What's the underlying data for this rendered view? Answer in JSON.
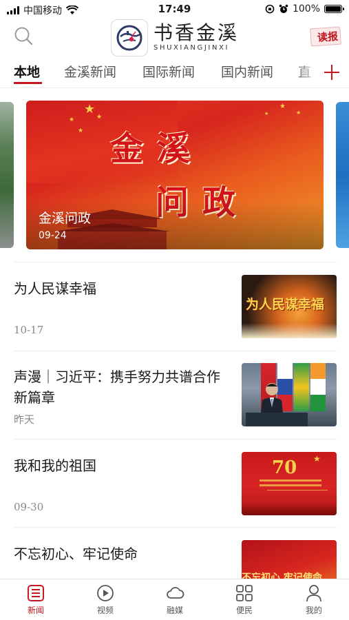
{
  "status_bar": {
    "carrier": "中国移动",
    "time": "17:49",
    "battery_text": "100%",
    "battery_level": 1.0
  },
  "header": {
    "logo_title": "书香金溪",
    "logo_subtitle": "SHUXIANGJINXI",
    "read_paper_label": "读报",
    "icons": {
      "search": "search-icon",
      "logo": "app-logo-icon",
      "read_paper": "newspaper-icon"
    }
  },
  "tabs": [
    {
      "label": "本地",
      "active": true
    },
    {
      "label": "金溪新闻",
      "active": false
    },
    {
      "label": "国际新闻",
      "active": false
    },
    {
      "label": "国内新闻",
      "active": false
    },
    {
      "label": "直",
      "active": false
    }
  ],
  "banner": {
    "art_title_line1": "金溪",
    "art_title_line2": "问政",
    "caption": "金溪问政",
    "date": "09-24"
  },
  "news": [
    {
      "title": "为人民谋幸福",
      "date": "10-17",
      "thumb_text": "为人民谋幸福"
    },
    {
      "title": "声漫｜习近平：携手努力共谱合作新篇章",
      "date": "昨天",
      "thumb_text": ""
    },
    {
      "title": "我和我的祖国",
      "date": "09-30",
      "thumb_text": "70"
    },
    {
      "title": "不忘初心、牢记使命",
      "date": "",
      "thumb_text": "不忘初心 牢记使命"
    }
  ],
  "bottom_nav": [
    {
      "label": "新闻",
      "icon": "news-list-icon",
      "active": true
    },
    {
      "label": "视频",
      "icon": "play-icon",
      "active": false
    },
    {
      "label": "融媒",
      "icon": "cloud-icon",
      "active": false
    },
    {
      "label": "便民",
      "icon": "grid-icon",
      "active": false
    },
    {
      "label": "我的",
      "icon": "user-icon",
      "active": false
    }
  ],
  "colors": {
    "accent": "#c8161d",
    "text": "#1a1a1a",
    "muted": "#888888",
    "divider": "#ececec"
  }
}
